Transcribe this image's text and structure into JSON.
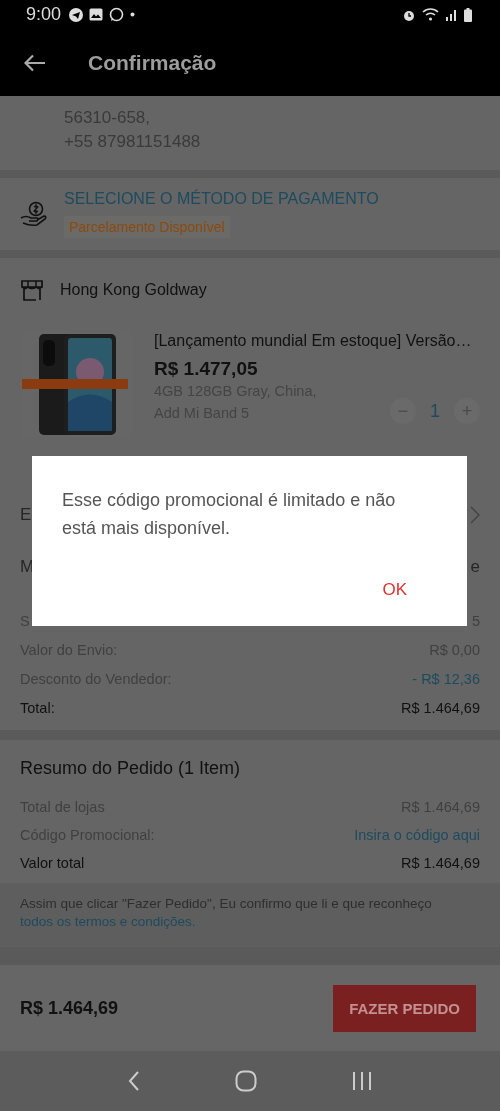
{
  "status_bar": {
    "time": "9:00"
  },
  "header": {
    "title": "Confirmação"
  },
  "address": {
    "lines": [
      "56310-658,",
      "+55 87981151488"
    ]
  },
  "payment": {
    "title": "SELECIONE O MÉTODO DE PAGAMENTO",
    "badge": "Parcelamento Disponível"
  },
  "store": {
    "name": "Hong Kong Goldway"
  },
  "product": {
    "image": {
      "kind": "picture"
    },
    "title": "[Lançamento mundial Em estoque] Versão…",
    "price": "R$ 1.477,05",
    "variant": [
      "4GB 128GB Gray, China,",
      "Add Mi Band 5"
    ],
    "minus": "−",
    "quantity": "1",
    "plus": "+"
  },
  "obscured_rows": [
    {
      "left": "E",
      "right": "",
      "chevron": true
    },
    {
      "left": "M",
      "right": "e",
      "chevron": false
    }
  ],
  "price_rows": [
    {
      "label": "S",
      "value": "5",
      "kind": "muted"
    },
    {
      "label": "Valor do Envio:",
      "value": "R$ 0,00",
      "kind": "muted"
    },
    {
      "label": "Desconto do Vendedor:",
      "value": "- R$ 12,36",
      "kind": "discount"
    },
    {
      "label": "Total:",
      "value": "R$ 1.464,69",
      "kind": "strong"
    }
  ],
  "summary": {
    "title": "Resumo do Pedido (1 Item)",
    "rows": [
      {
        "label": "Total de lojas",
        "value": "R$ 1.464,69",
        "kind": "muted"
      },
      {
        "label": "Código Promocional:",
        "value": "Insira o código aqui",
        "kind": "link"
      },
      {
        "label": "Valor total",
        "value": "R$ 1.464,69",
        "kind": "strong"
      }
    ]
  },
  "terms": {
    "text": "Assim que clicar \"Fazer Pedido\", Eu confirmo que li e que reconheço",
    "link": "todos os termos e condições."
  },
  "footer": {
    "total": "R$ 1.464,69",
    "button": "FAZER PEDIDO"
  },
  "dialog": {
    "message": "Esse código promocional é limitado e não está mais disponível.",
    "button": "OK"
  }
}
